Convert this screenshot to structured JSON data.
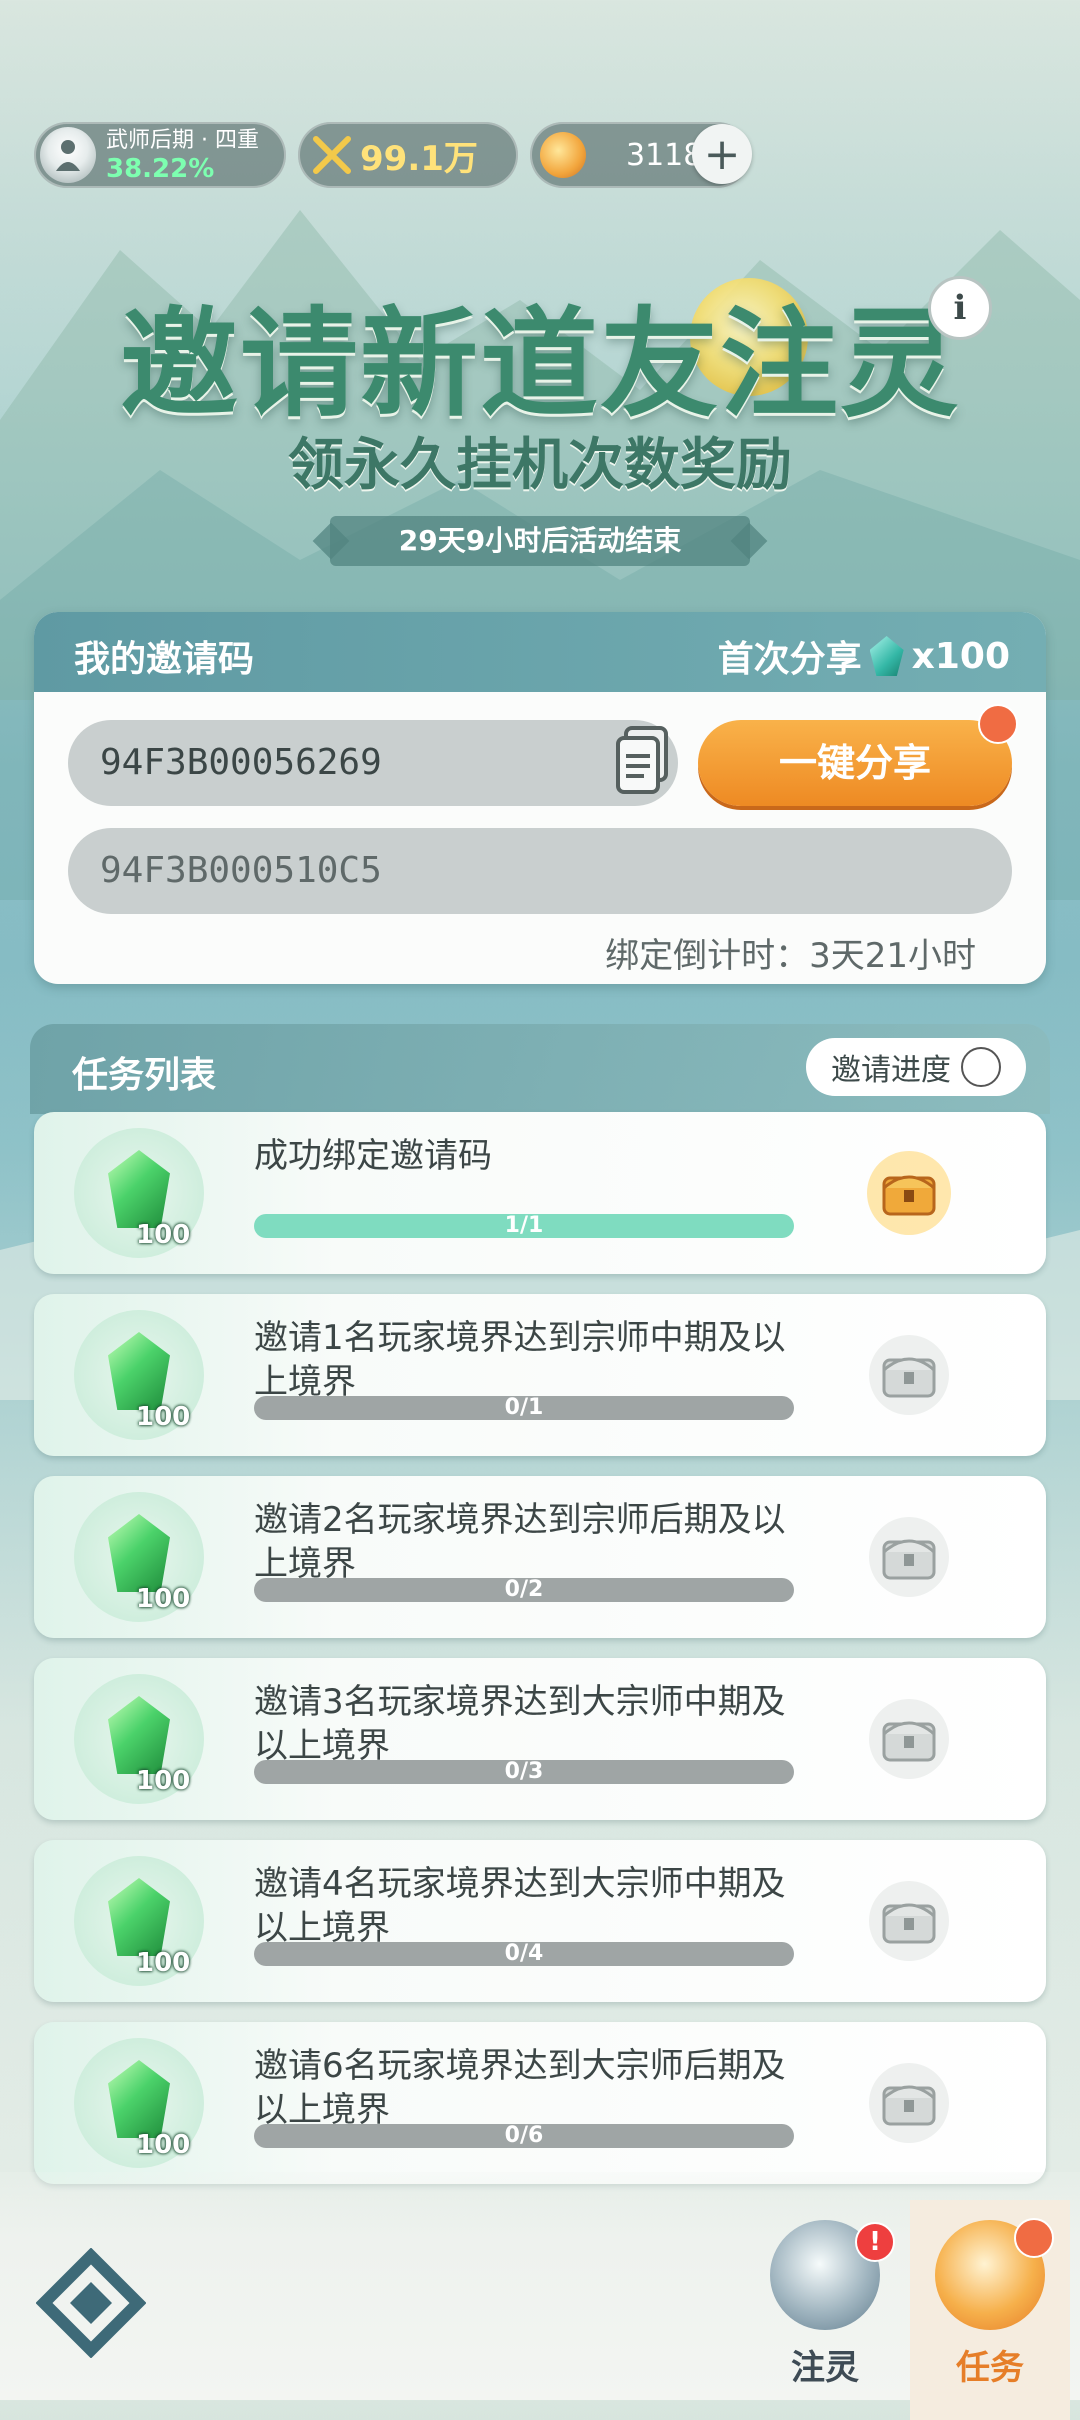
{
  "status": {
    "rank_title": "武师后期 · 四重",
    "rank_percent": "38.22%",
    "power": "99.1万",
    "coins": "3118"
  },
  "header": {
    "title": "邀请新道友注灵",
    "subtitle": "领永久挂机次数奖励",
    "countdown": "29天9小时后活动结束",
    "info_label": "i"
  },
  "invite": {
    "title": "我的邀请码",
    "first_share_label": "首次分享",
    "first_share_reward": "x100",
    "my_code": "94F3B00056269",
    "bind_code_value": "94F3B000510C5",
    "share_button": "一键分享",
    "bind_countdown": "绑定倒计时：3天21小时"
  },
  "tasks": {
    "title": "任务列表",
    "progress_button": "邀请进度",
    "items": [
      {
        "name": "成功绑定邀请码",
        "reward": "100",
        "progress_text": "1/1",
        "progress": 1.0,
        "claimable": true
      },
      {
        "name": "邀请1名玩家境界达到宗师中期及以上境界",
        "reward": "100",
        "progress_text": "0/1",
        "progress": 0,
        "claimable": false
      },
      {
        "name": "邀请2名玩家境界达到宗师后期及以上境界",
        "reward": "100",
        "progress_text": "0/2",
        "progress": 0,
        "claimable": false
      },
      {
        "name": "邀请3名玩家境界达到大宗师中期及以上境界",
        "reward": "100",
        "progress_text": "0/3",
        "progress": 0,
        "claimable": false
      },
      {
        "name": "邀请4名玩家境界达到大宗师中期及以上境界",
        "reward": "100",
        "progress_text": "0/4",
        "progress": 0,
        "claimable": false
      },
      {
        "name": "邀请6名玩家境界达到大宗师后期及以上境界",
        "reward": "100",
        "progress_text": "0/6",
        "progress": 0,
        "claimable": false
      }
    ]
  },
  "nav": {
    "tab_zhuling": "注灵",
    "tab_task": "任务",
    "zhuling_badge": "!"
  },
  "colors": {
    "accent_orange": "#ee8a23",
    "progress_fill": "#7fdcc0",
    "title_green": "#3c8a6e"
  }
}
